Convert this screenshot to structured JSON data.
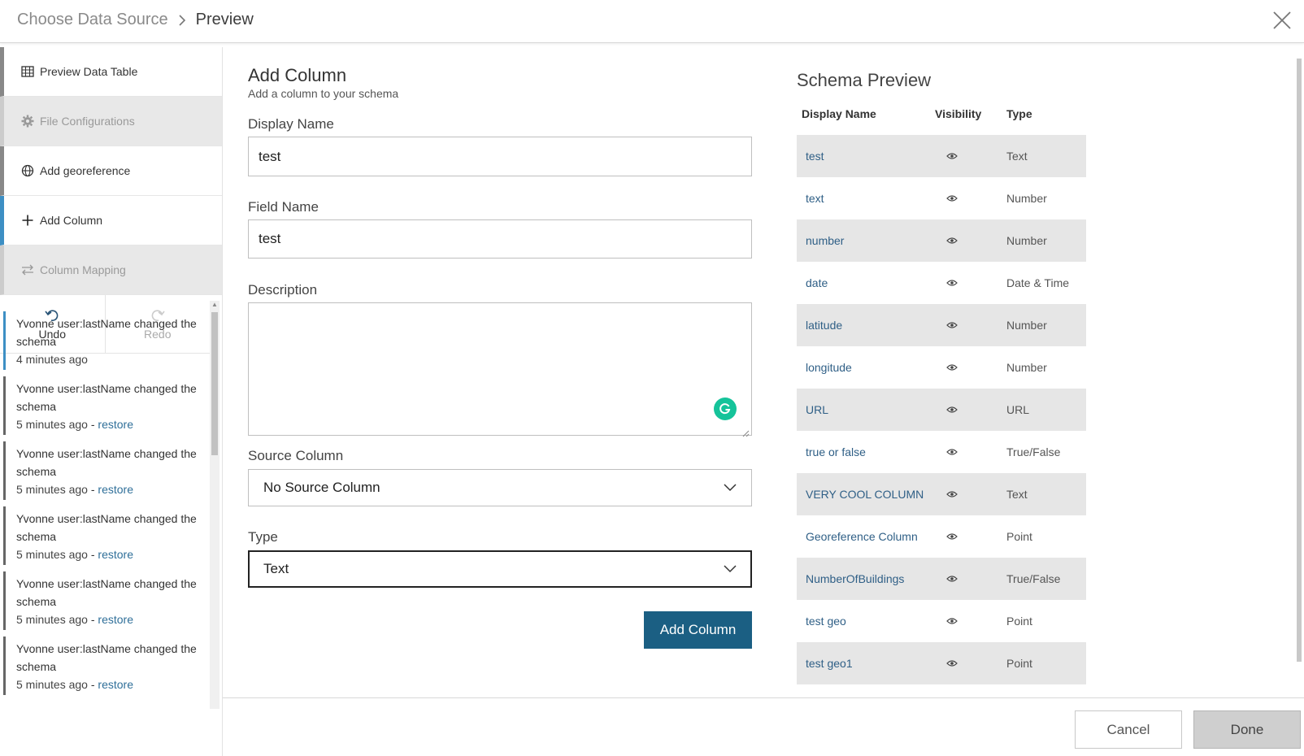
{
  "header": {
    "breadcrumb_prev": "Choose Data Source",
    "breadcrumb_current": "Preview"
  },
  "nav": {
    "items": [
      {
        "label": "Preview Data Table",
        "icon": "table-icon"
      },
      {
        "label": "File Configurations",
        "icon": "gear-icon"
      },
      {
        "label": "Add georeference",
        "icon": "globe-icon"
      },
      {
        "label": "Add Column",
        "icon": "plus-icon"
      },
      {
        "label": "Column Mapping",
        "icon": "swap-arrows-icon"
      }
    ],
    "undo_label": "Undo",
    "redo_label": "Redo"
  },
  "history": [
    {
      "text": "Yvonne user:lastName changed the schema",
      "time": "4 minutes ago",
      "restore": ""
    },
    {
      "text": "Yvonne user:lastName changed the schema",
      "time": "5 minutes ago",
      "restore": "restore"
    },
    {
      "text": "Yvonne user:lastName changed the schema",
      "time": "5 minutes ago",
      "restore": "restore"
    },
    {
      "text": "Yvonne user:lastName changed the schema",
      "time": "5 minutes ago",
      "restore": "restore"
    },
    {
      "text": "Yvonne user:lastName changed the schema",
      "time": "5 minutes ago",
      "restore": "restore"
    },
    {
      "text": "Yvonne user:lastName changed the schema",
      "time": "5 minutes ago",
      "restore": "restore"
    }
  ],
  "form": {
    "title": "Add Column",
    "subtitle": "Add a column to your schema",
    "display_name_label": "Display Name",
    "display_name_value": "test",
    "field_name_label": "Field Name",
    "field_name_value": "test",
    "description_label": "Description",
    "description_value": "",
    "source_column_label": "Source Column",
    "source_column_value": "No Source Column",
    "type_label": "Type",
    "type_value": "Text",
    "add_button": "Add Column"
  },
  "schema": {
    "title": "Schema Preview",
    "headers": [
      "Display Name",
      "Visibility",
      "Type"
    ],
    "rows": [
      {
        "name": "test",
        "type": "Text"
      },
      {
        "name": "text",
        "type": "Number"
      },
      {
        "name": "number",
        "type": "Number"
      },
      {
        "name": "date",
        "type": "Date & Time"
      },
      {
        "name": "latitude",
        "type": "Number"
      },
      {
        "name": "longitude",
        "type": "Number"
      },
      {
        "name": "URL",
        "type": "URL"
      },
      {
        "name": "true or false",
        "type": "True/False"
      },
      {
        "name": "VERY COOL COLUMN",
        "type": "Text"
      },
      {
        "name": "Georeference Column",
        "type": "Point"
      },
      {
        "name": "NumberOfBuildings",
        "type": "True/False"
      },
      {
        "name": "test geo",
        "type": "Point"
      },
      {
        "name": "test geo1",
        "type": "Point"
      }
    ]
  },
  "footer": {
    "cancel_label": "Cancel",
    "done_label": "Done"
  },
  "colors": {
    "accent": "#1b5f83",
    "link": "#2f6f99",
    "active_bar": "#3d8fc4",
    "grammarly": "#15c39a"
  }
}
